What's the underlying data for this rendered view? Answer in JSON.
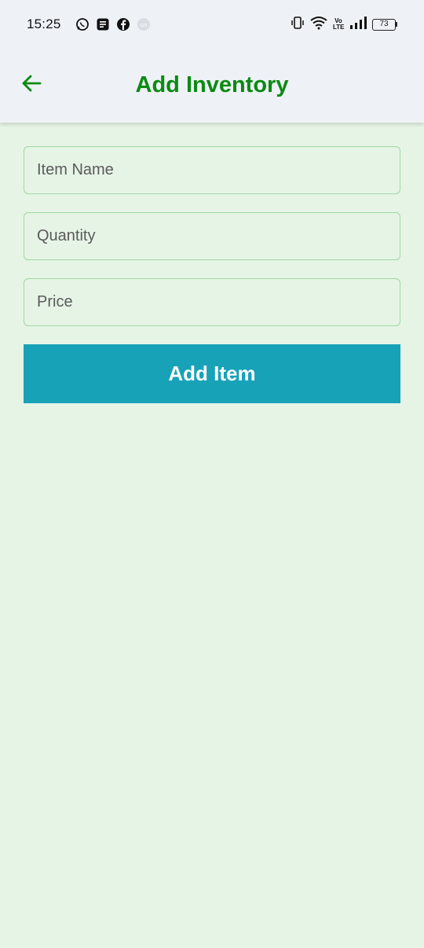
{
  "status_bar": {
    "time": "15:25",
    "notification_icons": [
      "whatsapp-icon",
      "note-icon",
      "facebook-icon",
      "app-circle-icon"
    ],
    "battery_level": "73",
    "network_label": "Vo LTE"
  },
  "app_bar": {
    "title": "Add Inventory",
    "back_icon": "arrow-left-icon",
    "title_color": "#0b8a12"
  },
  "form": {
    "item_name": {
      "placeholder": "Item Name",
      "value": ""
    },
    "quantity": {
      "placeholder": "Quantity",
      "value": ""
    },
    "price": {
      "placeholder": "Price",
      "value": ""
    },
    "submit_label": "Add Item",
    "submit_color": "#18a2b8"
  },
  "colors": {
    "background": "#e6f4e6",
    "field_border": "#9fd79f"
  }
}
